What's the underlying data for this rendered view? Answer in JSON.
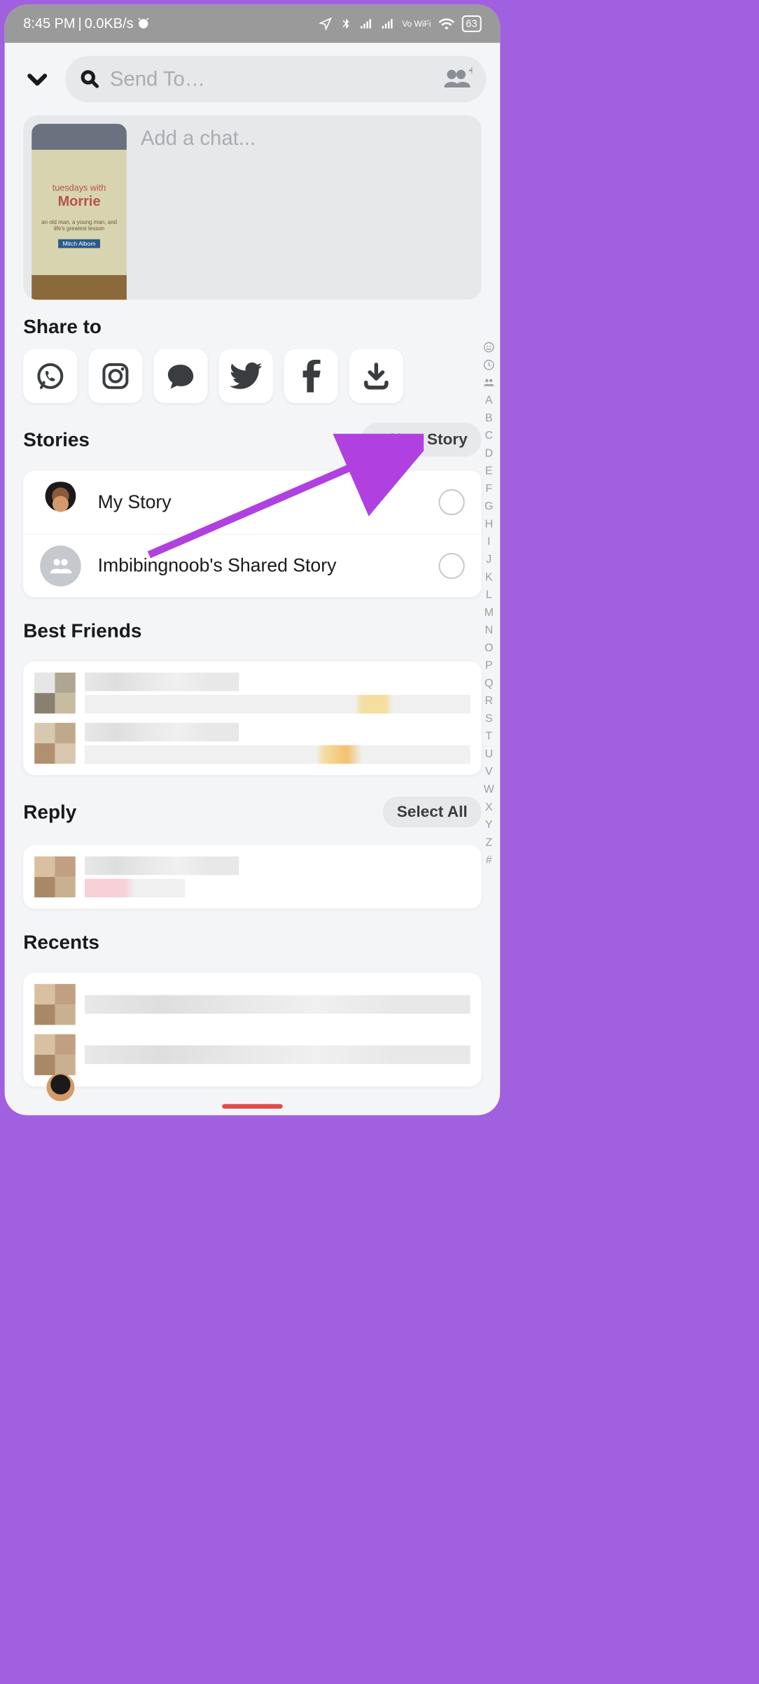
{
  "status_bar": {
    "time": "8:45 PM",
    "speed": "0.0KB/s",
    "vowifi": "Vo WiFi",
    "battery": "63"
  },
  "search": {
    "placeholder": "Send To…"
  },
  "chat_card": {
    "placeholder": "Add a chat...",
    "book_title": "tuesdays with",
    "book_name": "Morrie",
    "book_sub": "an old man, a young man, and life's greatest lesson",
    "book_author": "Mitch Albom"
  },
  "share_section": {
    "title": "Share to",
    "targets": [
      "whatsapp",
      "instagram",
      "messages",
      "twitter",
      "facebook",
      "download"
    ]
  },
  "stories_section": {
    "title": "Stories",
    "new_story": "New Story",
    "items": [
      {
        "label": "My Story"
      },
      {
        "label": "Imbibingnoob's Shared Story"
      }
    ]
  },
  "best_friends_section": {
    "title": "Best Friends"
  },
  "reply_section": {
    "title": "Reply",
    "select_all": "Select All"
  },
  "recents_section": {
    "title": "Recents"
  },
  "alpha_index": [
    "A",
    "B",
    "C",
    "D",
    "E",
    "F",
    "G",
    "H",
    "I",
    "J",
    "K",
    "L",
    "M",
    "N",
    "O",
    "P",
    "Q",
    "R",
    "S",
    "T",
    "U",
    "V",
    "W",
    "X",
    "Y",
    "Z",
    "#"
  ]
}
